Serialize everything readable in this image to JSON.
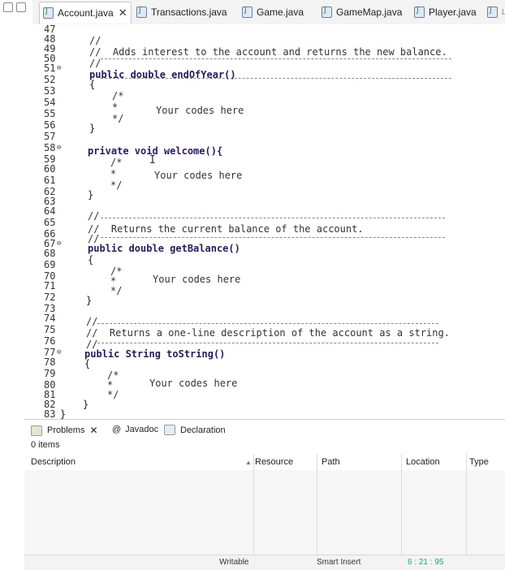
{
  "tabs": [
    {
      "label": "Account.java",
      "active": true
    },
    {
      "label": "Transactions.java",
      "active": false
    },
    {
      "label": "Game.java",
      "active": false
    },
    {
      "label": "GameMap.java",
      "active": false
    },
    {
      "label": "Player.java",
      "active": false
    },
    {
      "label": "L",
      "active": false
    }
  ],
  "editor": {
    "line_numbers": [
      "47",
      "48",
      "49",
      "50",
      "51",
      "52",
      "53",
      "54",
      "55",
      "56",
      "57",
      "58",
      "59",
      "60",
      "61",
      "62",
      "63",
      "64",
      "65",
      "66",
      "67",
      "68",
      "69",
      "70",
      "71",
      "72",
      "73",
      "74",
      "75",
      "76",
      "77",
      "78",
      "79",
      "80",
      "81",
      "82",
      "83"
    ],
    "code": {
      "c48": "//",
      "c49": "//  Adds interest to the account and returns the new balance.",
      "c50": "//",
      "c51": "public double endOfYear()",
      "c52": "{",
      "c53": "/*",
      "c54": "*",
      "c54b": "Your codes here",
      "c55": "*/",
      "c56": "}",
      "c58": "private void welcome(){",
      "c59": "/*",
      "c60": "*",
      "c60b": "Your codes here",
      "c61": "*/",
      "c62": "}",
      "c64": "//",
      "c65": "//  Returns the current balance of the account.",
      "c66": "//",
      "c67": "public double getBalance()",
      "c68": "{",
      "c69": "/*",
      "c70": "*",
      "c70b": "Your codes here",
      "c71": "*/",
      "c72": "}",
      "c74": "//",
      "c75": "//  Returns a one-line description of the account as a string.",
      "c76": "//",
      "c77": "public String toString()",
      "c78": "{",
      "c79": "/*",
      "c80": "*",
      "c80b": "Your codes here",
      "c81": "*/",
      "c82": "}",
      "c83": "}"
    }
  },
  "panel": {
    "tabs": [
      "Problems",
      "Javadoc",
      "Declaration"
    ],
    "item_count": "0 items",
    "columns": [
      "Description",
      "Resource",
      "Path",
      "Location",
      "Type"
    ]
  },
  "status": {
    "writable": "Writable",
    "insert_mode": "Smart Insert",
    "position": "6 : 21 : 95"
  }
}
